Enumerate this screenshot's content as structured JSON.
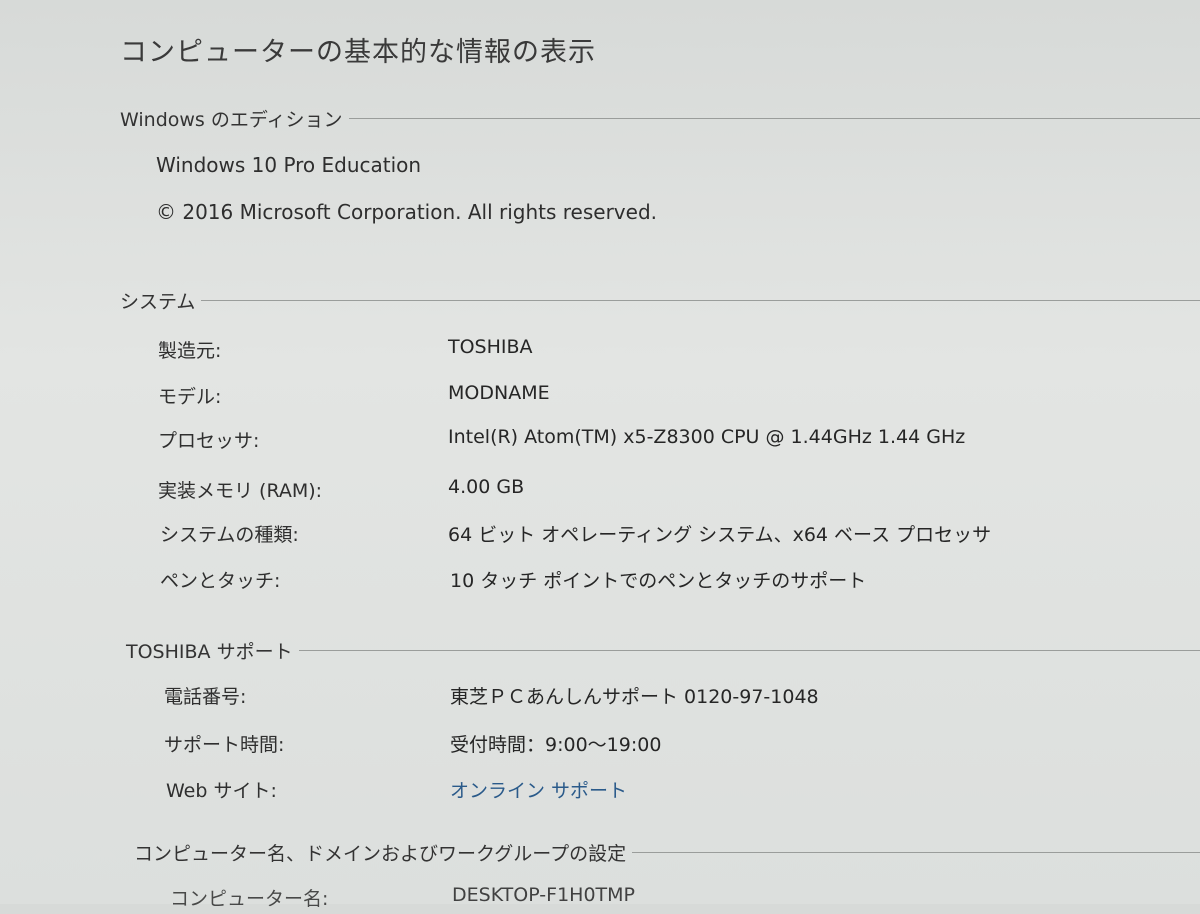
{
  "page": {
    "title": "コンピューターの基本的な情報の表示"
  },
  "edition": {
    "header": "Windows のエディション",
    "name": "Windows 10 Pro Education",
    "copyright": "© 2016 Microsoft Corporation. All rights reserved."
  },
  "system": {
    "header": "システム",
    "rows": [
      {
        "key": "製造元:",
        "value": "TOSHIBA"
      },
      {
        "key": "モデル:",
        "value": "MODNAME"
      },
      {
        "key": "プロセッサ:",
        "value": "Intel(R) Atom(TM) x5-Z8300  CPU @ 1.44GHz   1.44 GHz"
      },
      {
        "key": "実装メモリ (RAM):",
        "value": "4.00 GB"
      },
      {
        "key": "システムの種類:",
        "value": "64 ビット オペレーティング システム、x64 ベース プロセッサ"
      },
      {
        "key": "ペンとタッチ:",
        "value": "10 タッチ ポイントでのペンとタッチのサポート"
      }
    ]
  },
  "support": {
    "header": "TOSHIBA サポート",
    "rows": [
      {
        "key": "電話番号:",
        "value": "東芝ＰＣあんしんサポート 0120-97-1048"
      },
      {
        "key": "サポート時間:",
        "value": "受付時間：9:00～19:00"
      },
      {
        "key": "Web サイト:",
        "value": "オンライン サポート"
      }
    ]
  },
  "computer": {
    "header": "コンピューター名、ドメインおよびワークグループの設定",
    "rows": [
      {
        "key": "コンピューター名:",
        "value": "DESKTOP-F1H0TMP"
      }
    ]
  }
}
